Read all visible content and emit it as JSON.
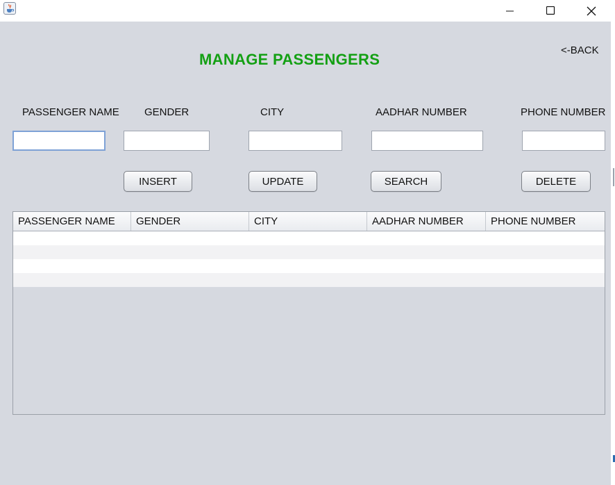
{
  "window": {
    "icon": "java-cup-icon",
    "controls": {
      "minimize": "minimize-icon",
      "maximize": "maximize-icon",
      "close": "close-icon"
    }
  },
  "header": {
    "title": "MANAGE PASSENGERS",
    "back_label": "<-BACK"
  },
  "form": {
    "fields": [
      {
        "label": "PASSENGER NAME",
        "value": ""
      },
      {
        "label": "GENDER",
        "value": ""
      },
      {
        "label": "CITY",
        "value": ""
      },
      {
        "label": "AADHAR NUMBER",
        "value": ""
      },
      {
        "label": "PHONE NUMBER",
        "value": ""
      }
    ]
  },
  "actions": {
    "insert": "INSERT",
    "update": "UPDATE",
    "search": "SEARCH",
    "delete": "DELETE"
  },
  "table": {
    "columns": [
      "PASSENGER NAME",
      "GENDER",
      "CITY",
      "AADHAR NUMBER",
      "PHONE NUMBER"
    ],
    "rows": [
      [
        "",
        "",
        "",
        "",
        ""
      ],
      [
        "",
        "",
        "",
        "",
        ""
      ],
      [
        "",
        "",
        "",
        "",
        ""
      ],
      [
        "",
        "",
        "",
        "",
        ""
      ]
    ]
  },
  "colors": {
    "title": "#14a014",
    "background": "#d6d9e0",
    "focus_border": "#7ea2d6"
  }
}
